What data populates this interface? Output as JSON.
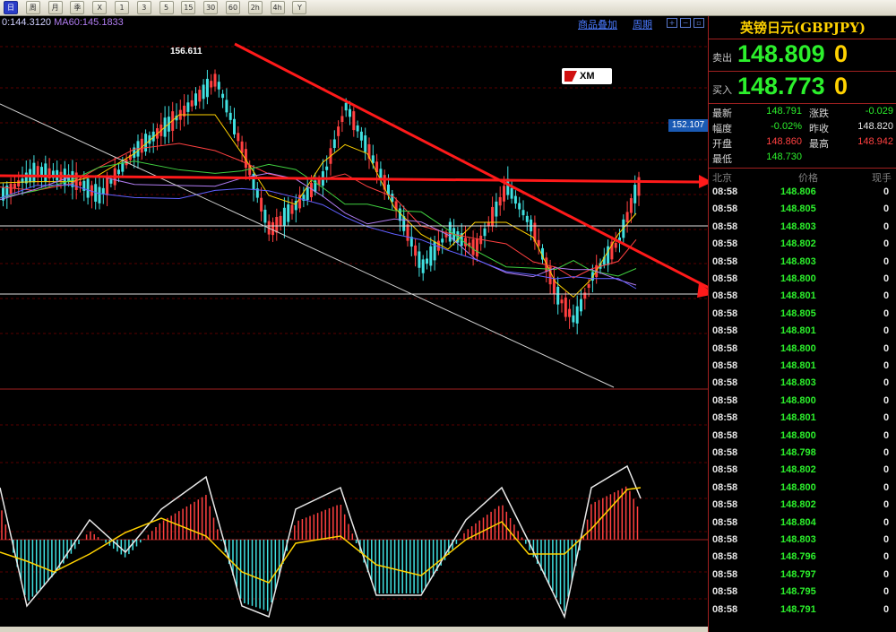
{
  "toolbar": {
    "buttons": [
      "日",
      "周",
      "月",
      "季",
      "X",
      "1",
      "3",
      "5",
      "15",
      "30",
      "60",
      "2h",
      "4h",
      "Y"
    ]
  },
  "chart": {
    "ma_info": {
      "ma30": "0:144.3120",
      "ma60": "MA60:145.1833"
    },
    "links": {
      "overlay": "商品叠加",
      "period": "周期"
    },
    "price_tag": "152.107",
    "peak_label": "156.611",
    "logo_text": "XM",
    "colors": {
      "up": "#ff4040",
      "down": "#40e0e0",
      "trend_line": "#ff1a1a",
      "support": "#ffffff"
    }
  },
  "panel": {
    "title": "英镑日元(GBPJPY)",
    "sell_label": "卖出",
    "sell_value": "148.809",
    "sell_tail": "0",
    "buy_label": "买入",
    "buy_value": "148.773",
    "buy_tail": "0",
    "stats": {
      "latest_label": "最新",
      "latest": "148.791",
      "change_label": "涨跌",
      "change": "-0.029",
      "amp_label": "幅度",
      "amp": "-0.02%",
      "prev_label": "昨收",
      "prev": "148.820",
      "open_label": "开盘",
      "open": "148.860",
      "high_label": "最高",
      "high": "148.942",
      "low_label": "最低",
      "low": "148.730"
    },
    "tick_header": {
      "time": "北京",
      "price": "价格",
      "volume": "现手"
    },
    "ticks": [
      {
        "time": "08:58",
        "price": "148.806",
        "vol": "0"
      },
      {
        "time": "08:58",
        "price": "148.805",
        "vol": "0"
      },
      {
        "time": "08:58",
        "price": "148.803",
        "vol": "0"
      },
      {
        "time": "08:58",
        "price": "148.802",
        "vol": "0"
      },
      {
        "time": "08:58",
        "price": "148.803",
        "vol": "0"
      },
      {
        "time": "08:58",
        "price": "148.800",
        "vol": "0"
      },
      {
        "time": "08:58",
        "price": "148.801",
        "vol": "0"
      },
      {
        "time": "08:58",
        "price": "148.805",
        "vol": "0"
      },
      {
        "time": "08:58",
        "price": "148.801",
        "vol": "0"
      },
      {
        "time": "08:58",
        "price": "148.800",
        "vol": "0"
      },
      {
        "time": "08:58",
        "price": "148.801",
        "vol": "0"
      },
      {
        "time": "08:58",
        "price": "148.803",
        "vol": "0"
      },
      {
        "time": "08:58",
        "price": "148.800",
        "vol": "0"
      },
      {
        "time": "08:58",
        "price": "148.801",
        "vol": "0"
      },
      {
        "time": "08:58",
        "price": "148.800",
        "vol": "0"
      },
      {
        "time": "08:58",
        "price": "148.798",
        "vol": "0"
      },
      {
        "time": "08:58",
        "price": "148.802",
        "vol": "0"
      },
      {
        "time": "08:58",
        "price": "148.800",
        "vol": "0"
      },
      {
        "time": "08:58",
        "price": "148.802",
        "vol": "0"
      },
      {
        "time": "08:58",
        "price": "148.804",
        "vol": "0"
      },
      {
        "time": "08:58",
        "price": "148.803",
        "vol": "0"
      },
      {
        "time": "08:58",
        "price": "148.796",
        "vol": "0"
      },
      {
        "time": "08:58",
        "price": "148.797",
        "vol": "0"
      },
      {
        "time": "08:58",
        "price": "148.795",
        "vol": "0"
      },
      {
        "time": "08:58",
        "price": "148.791",
        "vol": "0"
      }
    ]
  }
}
